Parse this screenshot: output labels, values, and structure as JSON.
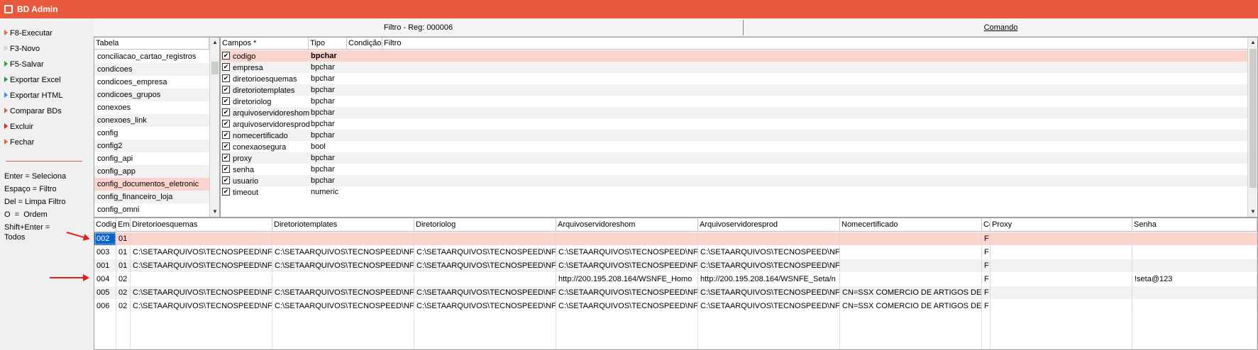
{
  "app": {
    "title": "BD Admin"
  },
  "sidebar": {
    "menu": [
      {
        "label": "F8-Executar",
        "color": "#e2682c"
      },
      {
        "label": "F3-Novo",
        "color": "#cfcfcf"
      },
      {
        "label": "F5-Salvar",
        "color": "#2f9e3a"
      },
      {
        "label": "Exportar Excel",
        "color": "#2f8f3a"
      },
      {
        "label": "Exportar HTML",
        "color": "#3a8fd8"
      },
      {
        "label": "Comparar BDs",
        "color": "#c86464"
      },
      {
        "label": "Excluir",
        "color": "#d82030"
      },
      {
        "label": "Fechar",
        "color": "#e2682c"
      }
    ],
    "help": [
      "Enter = Seleciona",
      "Espaço = Filtro",
      "Del = Limpa Filtro",
      "O  =  Ordem",
      "Shift+Enter =\nTodos"
    ]
  },
  "filterbar": {
    "filter_label": "Filtro - Reg: 000006",
    "command_label": "Comando"
  },
  "tables": {
    "header": "Tabela",
    "items": [
      "conciliacao_cartao_registros",
      "condicoes",
      "condicoes_empresa",
      "condicoes_grupos",
      "conexoes",
      "conexoes_link",
      "config",
      "config2",
      "config_api",
      "config_app",
      "config_documentos_eletronic",
      "config_financeiro_loja",
      "config_omni"
    ],
    "selected_index": 10
  },
  "fields": {
    "headers": [
      "Campos *",
      "Tipo",
      "Condição",
      "Filtro"
    ],
    "items": [
      {
        "name": "codigo",
        "type": "bpchar",
        "checked": true
      },
      {
        "name": "empresa",
        "type": "bpchar",
        "checked": true
      },
      {
        "name": "diretorioesquemas",
        "type": "bpchar",
        "checked": true
      },
      {
        "name": "diretoriotemplates",
        "type": "bpchar",
        "checked": true
      },
      {
        "name": "diretoriolog",
        "type": "bpchar",
        "checked": true
      },
      {
        "name": "arquivoservidoreshom",
        "type": "bpchar",
        "checked": true
      },
      {
        "name": "arquivoservidoresprod",
        "type": "bpchar",
        "checked": true
      },
      {
        "name": "nomecertificado",
        "type": "bpchar",
        "checked": true
      },
      {
        "name": "conexaosegura",
        "type": "bool",
        "checked": true
      },
      {
        "name": "proxy",
        "type": "bpchar",
        "checked": true
      },
      {
        "name": "senha",
        "type": "bpchar",
        "checked": true
      },
      {
        "name": "usuario",
        "type": "bpchar",
        "checked": true
      },
      {
        "name": "timeout",
        "type": "numeric",
        "checked": true
      }
    ]
  },
  "grid": {
    "headers": [
      "Codig",
      "Emp",
      "Diretorioesquemas",
      "Diretoriotemplates",
      "Diretoriolog",
      "Arquivoservidoreshom",
      "Arquivoservidoresprod",
      "Nomecertificado",
      "Co",
      "Proxy",
      "Senha"
    ],
    "rows": [
      [
        "002",
        "01",
        "",
        "",
        "",
        "",
        "",
        "",
        "F",
        "",
        ""
      ],
      [
        "003",
        "01",
        "C:\\SETAARQUIVOS\\TECNOSPEED\\NF",
        "C:\\SETAARQUIVOS\\TECNOSPEED\\NF",
        "C:\\SETAARQUIVOS\\TECNOSPEED\\NF",
        "C:\\SETAARQUIVOS\\TECNOSPEED\\NF",
        "C:\\SETAARQUIVOS\\TECNOSPEED\\NF",
        "",
        "F",
        "",
        ""
      ],
      [
        "001",
        "01",
        "C:\\SETAARQUIVOS\\TECNOSPEED\\NF",
        "C:\\SETAARQUIVOS\\TECNOSPEED\\NF",
        "C:\\SETAARQUIVOS\\TECNOSPEED\\NF",
        "C:\\SETAARQUIVOS\\TECNOSPEED\\NF",
        "C:\\SETAARQUIVOS\\TECNOSPEED\\NF",
        "",
        "F",
        "",
        ""
      ],
      [
        "004",
        "02",
        "",
        "",
        "",
        "http://200.195.208.164/WSNFE_Homo",
        "http://200.195.208.164/WSNFE_Seta/n",
        "",
        "F",
        "",
        "!seta@123"
      ],
      [
        "005",
        "02",
        "C:\\SETAARQUIVOS\\TECNOSPEED\\NF",
        "C:\\SETAARQUIVOS\\TECNOSPEED\\NF",
        "C:\\SETAARQUIVOS\\TECNOSPEED\\NF",
        "C:\\SETAARQUIVOS\\TECNOSPEED\\NF",
        "C:\\SETAARQUIVOS\\TECNOSPEED\\NF",
        "CN=SSX COMERCIO DE ARTIGOS DE",
        "F",
        "",
        ""
      ],
      [
        "006",
        "02",
        "C:\\SETAARQUIVOS\\TECNOSPEED\\NF",
        "C:\\SETAARQUIVOS\\TECNOSPEED\\NF",
        "C:\\SETAARQUIVOS\\TECNOSPEED\\NF",
        "C:\\SETAARQUIVOS\\TECNOSPEED\\NF",
        "C:\\SETAARQUIVOS\\TECNOSPEED\\NF",
        "CN=SSX COMERCIO DE ARTIGOS DE",
        "F",
        "",
        ""
      ]
    ],
    "selected_row": 0
  }
}
